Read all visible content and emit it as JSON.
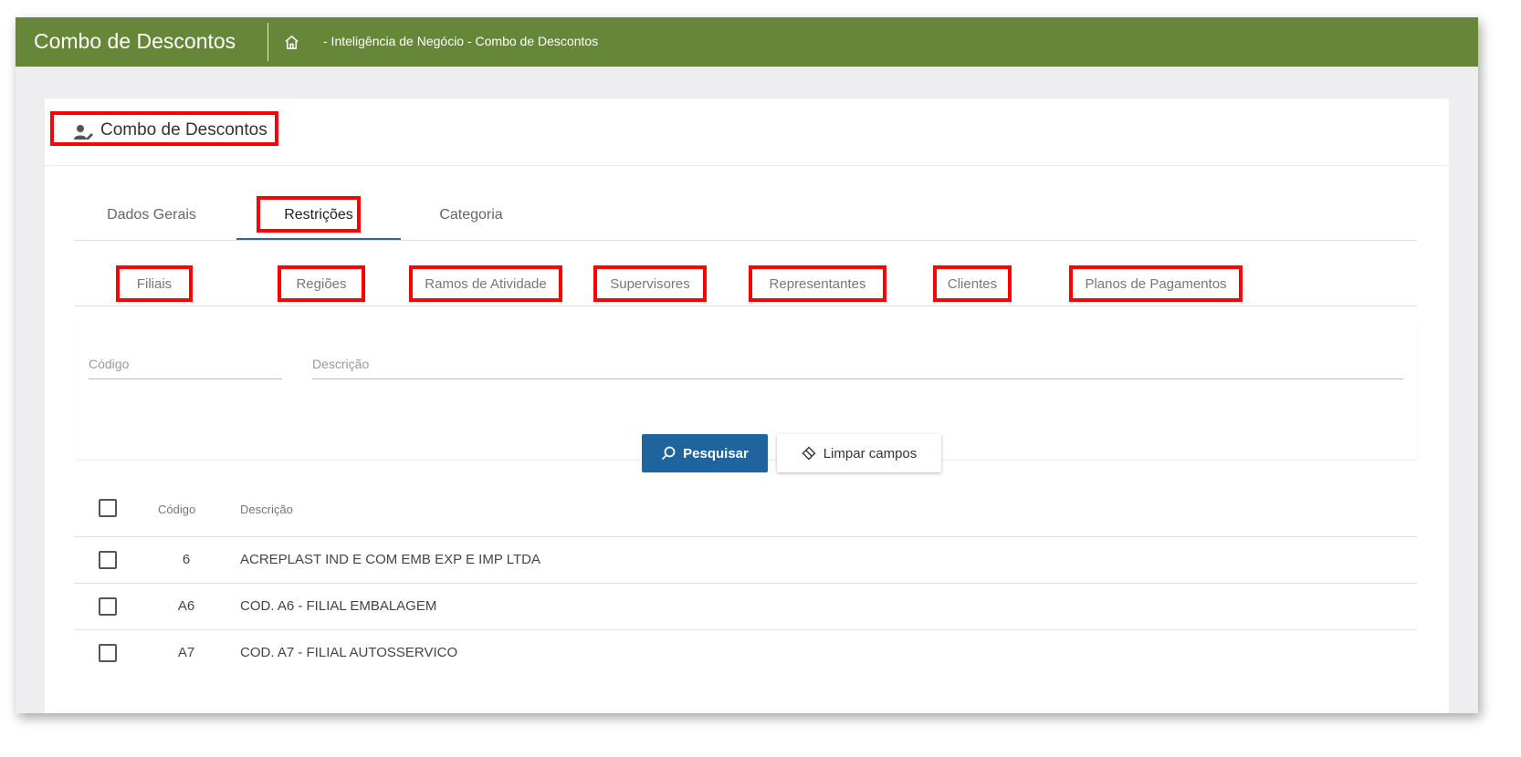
{
  "header": {
    "app_title": "Combo de Descontos",
    "breadcrumb": "- Inteligência de Negócio - Combo de Descontos"
  },
  "card": {
    "title": "Combo de Descontos"
  },
  "tabs": [
    {
      "label": "Dados Gerais"
    },
    {
      "label": "Restrições",
      "active": true
    },
    {
      "label": "Categoria"
    }
  ],
  "subtabs": [
    {
      "label": "Filiais"
    },
    {
      "label": "Regiões"
    },
    {
      "label": "Ramos de Atividade"
    },
    {
      "label": "Supervisores"
    },
    {
      "label": "Representantes"
    },
    {
      "label": "Clientes"
    },
    {
      "label": "Planos de Pagamentos"
    }
  ],
  "filters": {
    "codigo_placeholder": "Código",
    "descricao_placeholder": "Descrição",
    "search_label": "Pesquisar",
    "clear_label": "Limpar campos"
  },
  "table": {
    "headers": {
      "codigo": "Código",
      "descricao": "Descrição"
    },
    "rows": [
      {
        "codigo": "6",
        "descricao": "ACREPLAST IND E COM EMB EXP E IMP LTDA"
      },
      {
        "codigo": "A6",
        "descricao": "COD. A6 - FILIAL EMBALAGEM"
      },
      {
        "codigo": "A7",
        "descricao": "COD. A7 - FILIAL AUTOSSERVICO"
      }
    ]
  },
  "colors": {
    "topbar": "#658737",
    "primary_button": "#20649e",
    "highlight": "#ff0000",
    "tab_underline": "#2e5fb5"
  }
}
